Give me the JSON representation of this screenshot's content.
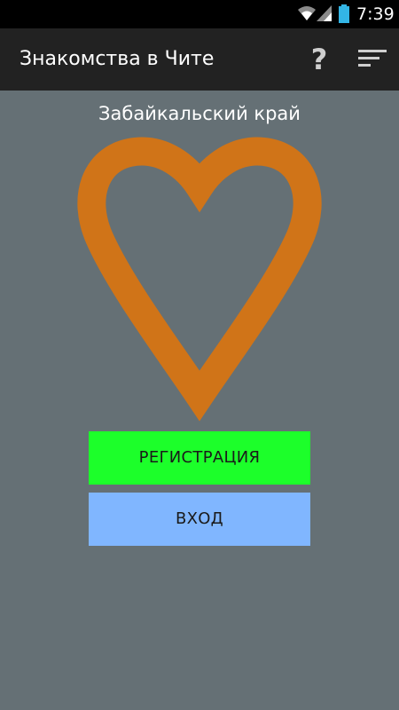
{
  "status_bar": {
    "time": "7:39",
    "icons": [
      "wifi-icon",
      "signal-icon",
      "battery-icon"
    ]
  },
  "action_bar": {
    "title": "Знакомства в Чите",
    "help_label": "?",
    "icons": [
      "help-icon",
      "menu-icon"
    ]
  },
  "main": {
    "region": "Забайкальский край",
    "heart_icon": "heart-outline-icon",
    "register_label": "РЕГИСТРАЦИЯ",
    "login_label": "ВХОД"
  },
  "colors": {
    "background": "#657075",
    "action_bar": "#222222",
    "heart": "#d07418",
    "register_button": "#1cff2a",
    "login_button": "#80b6ff"
  }
}
